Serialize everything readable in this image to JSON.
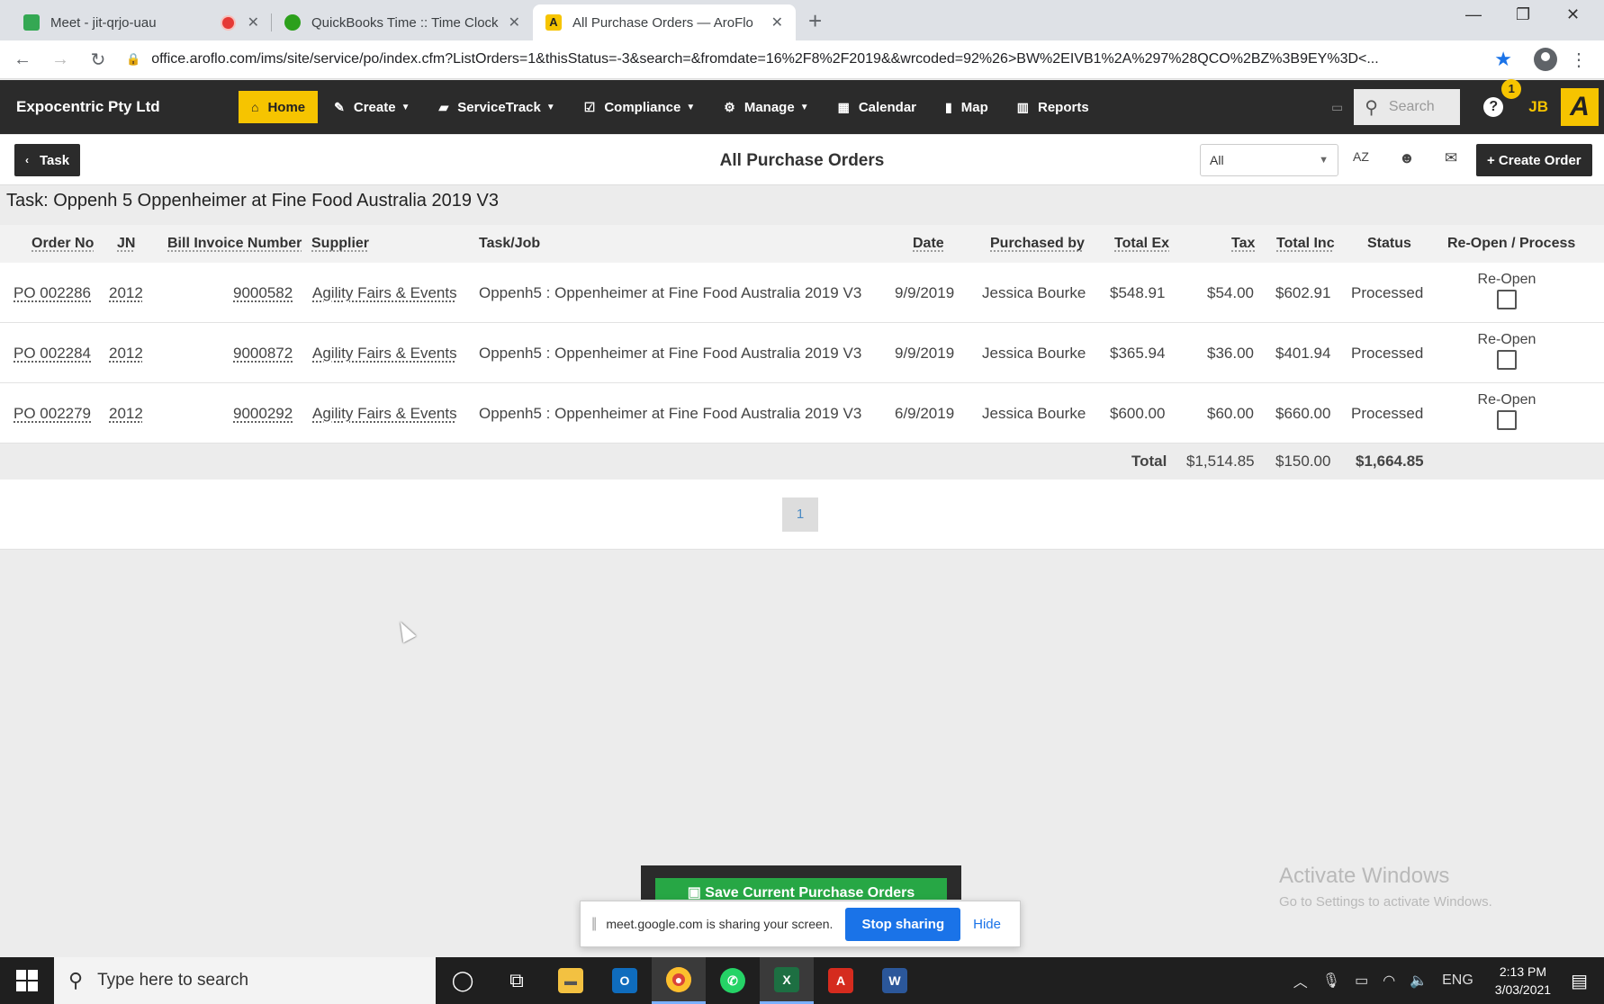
{
  "browser": {
    "tabs": [
      {
        "title": "Meet - jit-qrjo-uau",
        "favicon_color": "#34a853",
        "recording": true,
        "active": false
      },
      {
        "title": "QuickBooks Time :: Time Clock",
        "favicon_color": "#2ca01c",
        "recording": false,
        "active": false
      },
      {
        "title": "All Purchase Orders — AroFlo",
        "favicon_color": "#f6c400",
        "recording": false,
        "active": true
      }
    ],
    "new_tab_symbol": "+",
    "url": "office.aroflo.com/ims/site/service/po/index.cfm?ListOrders=1&thisStatus=-3&search=&fromdate=16%2F8%2F2019&&wrcoded=92%26>BW%2EIVB1%2A%297%28QCO%2BZ%3B9EY%3D<..."
  },
  "app": {
    "company": "Expocentric Pty Ltd",
    "nav": [
      {
        "label": "Home",
        "icon": "home-icon",
        "dropdown": false
      },
      {
        "label": "Create",
        "icon": "pencil-icon",
        "dropdown": true
      },
      {
        "label": "ServiceTrack",
        "icon": "briefcase-icon",
        "dropdown": true
      },
      {
        "label": "Compliance",
        "icon": "checkbox-icon",
        "dropdown": true
      },
      {
        "label": "Manage",
        "icon": "gear-icon",
        "dropdown": true
      },
      {
        "label": "Calendar",
        "icon": "calendar-icon",
        "dropdown": false
      },
      {
        "label": "Map",
        "icon": "map-icon",
        "dropdown": false
      },
      {
        "label": "Reports",
        "icon": "chart-icon",
        "dropdown": false
      }
    ],
    "search_placeholder": "Search",
    "notification_count": "1",
    "user_initials": "JB",
    "logo_letter": "A",
    "accent": "#f6c400"
  },
  "toolbar": {
    "back_label": "Task",
    "title": "All Purchase Orders",
    "filter_value": "All",
    "sort_label": "AZ",
    "create_label": "+ Create Order"
  },
  "task_heading": "Task: Oppenh 5 Oppenheimer at Fine Food Australia 2019 V3",
  "table": {
    "headers": {
      "order_no": "Order No",
      "jn": "JN",
      "bill_invoice": "Bill Invoice Number",
      "supplier": "Supplier",
      "task_job": "Task/Job",
      "date": "Date",
      "purchased_by": "Purchased by",
      "total_ex": "Total Ex",
      "tax": "Tax",
      "total_inc": "Total Inc",
      "status": "Status",
      "reopen": "Re-Open / Process"
    },
    "rows": [
      {
        "order_no": "PO 002286",
        "jn": "2012",
        "bill_invoice": "9000582",
        "supplier": "Agility Fairs & Events",
        "task_job": "Oppenh5 : Oppenheimer at Fine Food Australia 2019 V3",
        "date": "9/9/2019",
        "purchased_by": "Jessica Bourke",
        "total_ex": "$548.91",
        "tax": "$54.00",
        "total_inc": "$602.91",
        "status": "Processed",
        "reopen_label": "Re-Open"
      },
      {
        "order_no": "PO 002284",
        "jn": "2012",
        "bill_invoice": "9000872",
        "supplier": "Agility Fairs & Events",
        "task_job": "Oppenh5 : Oppenheimer at Fine Food Australia 2019 V3",
        "date": "9/9/2019",
        "purchased_by": "Jessica Bourke",
        "total_ex": "$365.94",
        "tax": "$36.00",
        "total_inc": "$401.94",
        "status": "Processed",
        "reopen_label": "Re-Open"
      },
      {
        "order_no": "PO 002279",
        "jn": "2012",
        "bill_invoice": "9000292",
        "supplier": "Agility Fairs & Events",
        "task_job": "Oppenh5 : Oppenheimer at Fine Food Australia 2019 V3",
        "date": "6/9/2019",
        "purchased_by": "Jessica Bourke",
        "total_ex": "$600.00",
        "tax": "$60.00",
        "total_inc": "$660.00",
        "status": "Processed",
        "reopen_label": "Re-Open"
      }
    ],
    "totals": {
      "label": "Total",
      "total_ex": "$1,514.85",
      "tax": "$150.00",
      "total_inc": "$1,664.85"
    }
  },
  "pagination": {
    "current_page": "1"
  },
  "save_button": "Save Current Purchase Orders",
  "sharing_bar": {
    "message": "meet.google.com is sharing your screen.",
    "stop_label": "Stop sharing",
    "hide_label": "Hide"
  },
  "watermark": {
    "line1": "Activate Windows",
    "line2": "Go to Settings to activate Windows."
  },
  "taskbar": {
    "search_placeholder": "Type here to search",
    "language": "ENG",
    "time": "2:13 PM",
    "date": "3/03/2021"
  }
}
